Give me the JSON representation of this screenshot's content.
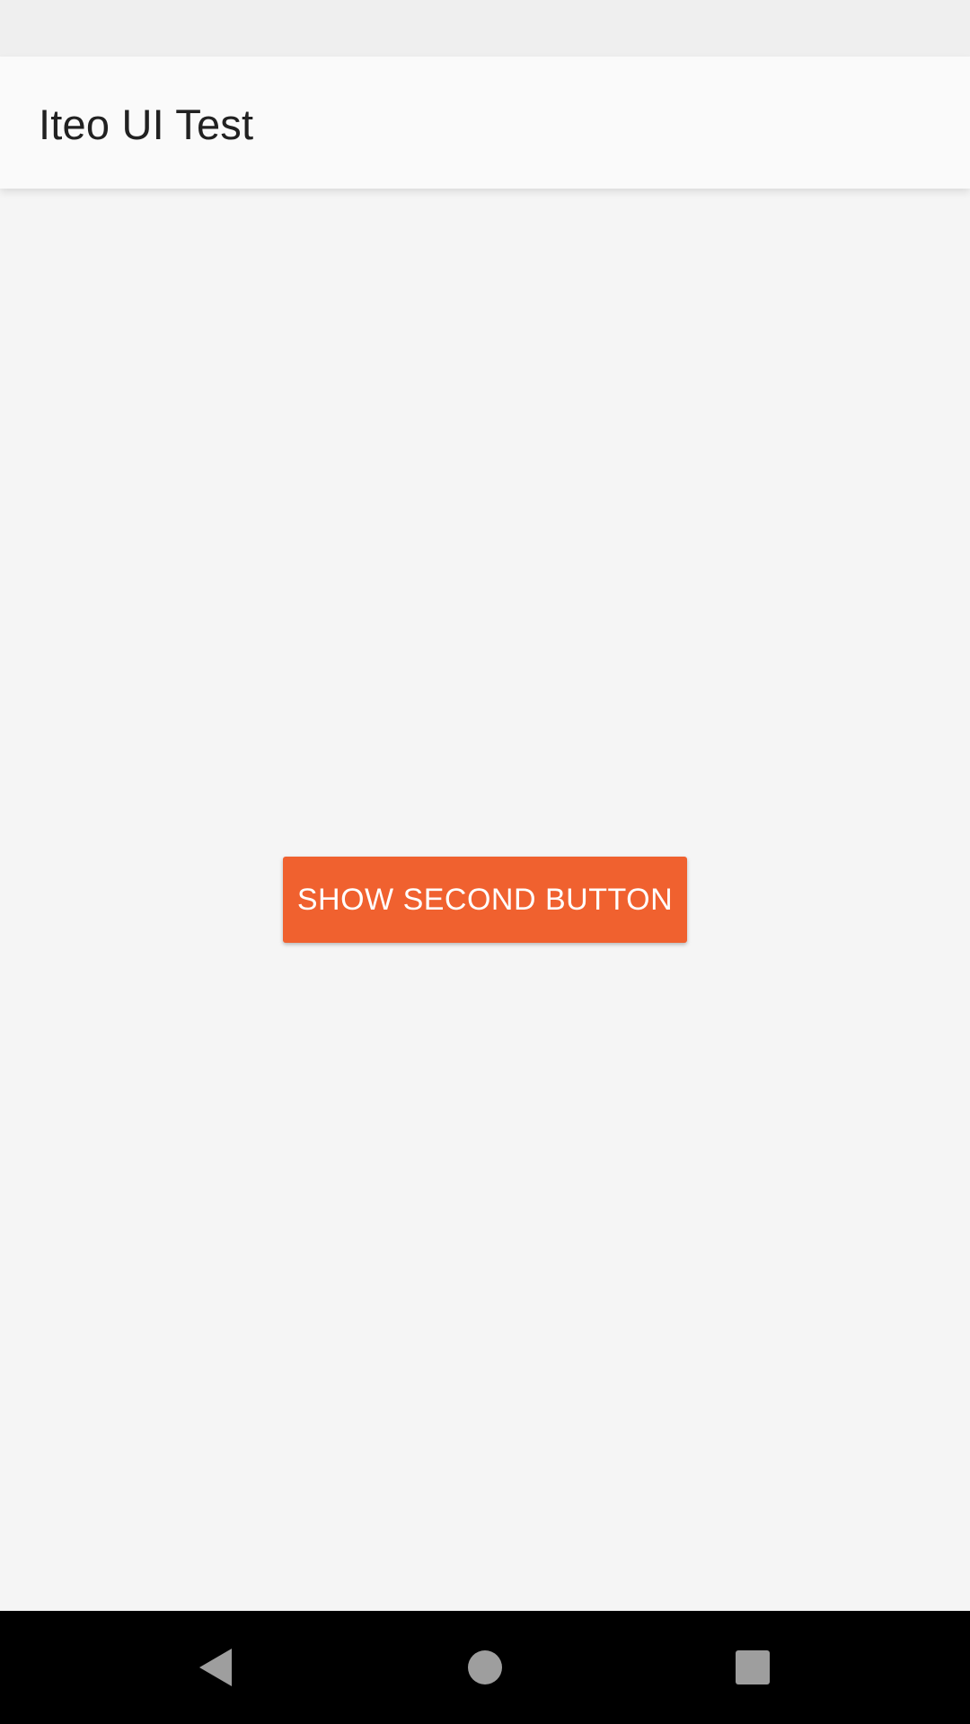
{
  "app_bar": {
    "title": "Iteo UI Test"
  },
  "main": {
    "show_second_button_label": "SHOW SECOND BUTTON"
  },
  "nav_bar": {
    "back_icon": "back-triangle-icon",
    "home_icon": "home-circle-icon",
    "recents_icon": "recents-square-icon"
  },
  "colors": {
    "accent_button": "#f0612f",
    "app_bar_background": "#fafafa",
    "content_background": "#f5f5f5",
    "nav_bar_background": "#000000",
    "nav_icon": "#9e9e9e"
  }
}
